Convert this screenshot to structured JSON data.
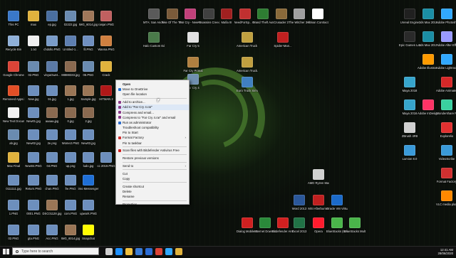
{
  "desktop_icons": [
    {
      "id": "this-pc",
      "label": "This PC",
      "color": "#3a78c9"
    },
    {
      "id": "max",
      "label": "max",
      "color": "#e0b23d"
    },
    {
      "id": "ep",
      "label": "ep.jpg",
      "color": "#4a6fa0"
    },
    {
      "id": "f0222",
      "label": "02222.jpg",
      "color": "#6a8bb0"
    },
    {
      "id": "img6014",
      "label": "IMG_6014.jpg",
      "color": "#a0785a"
    },
    {
      "id": "ranjan",
      "label": "ranjan.PNG",
      "color": "#c06060"
    },
    {
      "id": "recycle",
      "label": "Recycle Bin",
      "color": "#8fb0d8"
    },
    {
      "id": "one-txt",
      "label": "1.txt",
      "color": "#f0f0f0"
    },
    {
      "id": "chdollo",
      "label": "chdollo.PNG",
      "color": "#7a9cc8"
    },
    {
      "id": "untitled1",
      "label": "Untitled-1...",
      "color": "#5e7fb0"
    },
    {
      "id": "fil",
      "label": "fil.PNG",
      "color": "#7090c0"
    },
    {
      "id": "wanna",
      "label": "Wanna.PNG",
      "color": "#d08040"
    },
    {
      "id": "chrome",
      "label": "Google Chrome",
      "color": "#db4437"
    },
    {
      "id": "f02",
      "label": "02.PNG",
      "color": "#6a8bb0"
    },
    {
      "id": "vinyaw",
      "label": "vinyaGwet...",
      "color": "#5b7aa6"
    },
    {
      "id": "ss88",
      "label": "88888333.jpg",
      "color": "#8a6a50"
    },
    {
      "id": "f06",
      "label": "06.PNG",
      "color": "#6a8bb0"
    },
    {
      "id": "crack",
      "label": "Crack",
      "color": "#e0b23d"
    },
    {
      "id": "removed",
      "label": "Removed Apps.html",
      "color": "#e34f26"
    },
    {
      "id": "new",
      "label": "New.jpg",
      "color": "#6d8fbd"
    },
    {
      "id": "f91",
      "label": "91.jpg",
      "color": "#6d8fbd"
    },
    {
      "id": "jpg1",
      "label": "1.jpg",
      "color": "#9a7656"
    },
    {
      "id": "sample",
      "label": "Sample.jpg",
      "color": "#9a7656"
    },
    {
      "id": "hitman",
      "label": "HITMAN 2",
      "color": "#b01818"
    },
    {
      "id": "newtext",
      "label": "New Text Document...",
      "color": "#f0f0f0"
    },
    {
      "id": "new01",
      "label": "New01.jpg",
      "color": "#6d8fbd"
    },
    {
      "id": "aaaaa",
      "label": "aaaaa.jpg",
      "color": "#8a6a50"
    },
    {
      "id": "f0jpg",
      "label": "0.jpg",
      "color": "#8a6a50"
    },
    {
      "id": "f2jpg",
      "label": "2.jpg",
      "color": "#8a6a50"
    },
    {
      "id": "ab",
      "label": "ab.jpg",
      "color": "#6a8bb0"
    },
    {
      "id": "new02",
      "label": "New02.jpg",
      "color": "#6d8fbd"
    },
    {
      "id": "f2e",
      "label": "2e.png",
      "color": "#6d8fbd"
    },
    {
      "id": "wome2",
      "label": "Wome2.PNG",
      "color": "#6d8fbd"
    },
    {
      "id": "new03",
      "label": "New03.jpg",
      "color": "#6d8fbd"
    },
    {
      "id": "maxfinal",
      "label": "Max Final",
      "color": "#e0b23d"
    },
    {
      "id": "new04",
      "label": "New04.PNG",
      "color": "#6d8fbd"
    },
    {
      "id": "f04",
      "label": "04.PNG",
      "color": "#6d8fbd"
    },
    {
      "id": "up",
      "label": "up.png",
      "color": "#6d8fbd"
    },
    {
      "id": "ludo",
      "label": "ludo.jpg",
      "color": "#6d8fbd"
    },
    {
      "id": "cc2019",
      "label": "cc 2019.PNG",
      "color": "#6d8fbd"
    },
    {
      "id": "s0111",
      "label": "0111111.jpg",
      "color": "#6d8fbd"
    },
    {
      "id": "return",
      "label": "Return.PNG",
      "color": "#6d8fbd"
    },
    {
      "id": "chan",
      "label": "chan.PNG",
      "color": "#6d8fbd"
    },
    {
      "id": "fre",
      "label": "fre.PNG",
      "color": "#6d8fbd"
    },
    {
      "id": "imo",
      "label": "imo Messenger",
      "color": "#1f6fd6"
    },
    {
      "id": "f1png",
      "label": "1.PNG",
      "color": "#6d8fbd"
    },
    {
      "id": "f0001",
      "label": "0001.PNG",
      "color": "#6d8fbd"
    },
    {
      "id": "dsc",
      "label": "DSC01128.jpg",
      "color": "#9a7656"
    },
    {
      "id": "com",
      "label": "com.PNG",
      "color": "#6d8fbd"
    },
    {
      "id": "upwork",
      "label": "upwork.PNG",
      "color": "#6d8fbd"
    },
    {
      "id": "f02b",
      "label": "02.PNG",
      "color": "#6d8fbd"
    },
    {
      "id": "gta",
      "label": "gta.PNG",
      "color": "#6d8fbd"
    },
    {
      "id": "acc",
      "label": "Acc.PNG",
      "color": "#6d8fbd"
    },
    {
      "id": "img6014b",
      "label": "IMG_6014.jpg",
      "color": "#9a7656"
    },
    {
      "id": "snapchat",
      "label": "Snapchat",
      "color": "#fffc00"
    },
    {
      "id": "gtasa",
      "label": "MTA: San Andreas 1.5",
      "color": "#5a5a5a"
    },
    {
      "id": "rottr",
      "label": "Rise Of The Tomb Raider",
      "color": "#7a5b3a"
    },
    {
      "id": "fc-new-dawn",
      "label": "Far Cry - New Dawn",
      "color": "#c0407a"
    },
    {
      "id": "ac-od",
      "label": "Assassins Creed O...",
      "color": "#404040"
    },
    {
      "id": "mafia",
      "label": "Mafia III",
      "color": "#a02020"
    },
    {
      "id": "nfs",
      "label": "NeedForSp... Payback",
      "color": "#c03030"
    },
    {
      "id": "gtav",
      "label": "Grand Theft Auto V",
      "color": "#2e7d32"
    },
    {
      "id": "crusader",
      "label": "Crusader 3",
      "color": "#8a6a3a"
    },
    {
      "id": "witcher",
      "label": "The Witcher 3 Enhanced...",
      "color": "#a0a0a0"
    },
    {
      "id": "hitman-abs",
      "label": "Hitman Contracts...",
      "color": "#ffffff"
    },
    {
      "id": "halo",
      "label": "Halo Custom Edition",
      "color": "#4a7a4a"
    },
    {
      "id": "fc5",
      "label": "Far Cry 5",
      "color": "#e0e0e0"
    },
    {
      "id": "ats",
      "label": "American Truck Si...",
      "color": "#c0a040"
    },
    {
      "id": "spider",
      "label": "Spider-Man...",
      "color": "#c02020"
    },
    {
      "id": "fc-primal",
      "label": "Far Cry Primal",
      "color": "#b08040"
    },
    {
      "id": "american2",
      "label": "American Truck...",
      "color": "#c0a040"
    },
    {
      "id": "fc4",
      "label": "Far Cry 4",
      "color": "#7090b0"
    },
    {
      "id": "ets2",
      "label": "Euro Truck Simulator 2",
      "color": "#4080c0"
    },
    {
      "id": "amd",
      "label": "AMD Ryzen Master",
      "color": "#d0d0d0"
    },
    {
      "id": "word",
      "label": "Word 2013",
      "color": "#2b579a"
    },
    {
      "id": "msi",
      "label": "MSI Afterburner",
      "color": "#c02020"
    },
    {
      "id": "vbox",
      "label": "Oracle VM VirtualBox",
      "color": "#1b6ac9"
    },
    {
      "id": "dialog",
      "label": "Dialog Mobile B...",
      "color": "#d02020"
    },
    {
      "id": "idm",
      "label": "Internet Downlo...",
      "color": "#2a8a3a"
    },
    {
      "id": "bitdef",
      "label": "Bitdefender Antivirus Free",
      "color": "#d02020"
    },
    {
      "id": "excel",
      "label": "Excel 2013",
      "color": "#217346"
    },
    {
      "id": "opera",
      "label": "Opera",
      "color": "#ff1b2d"
    },
    {
      "id": "bluestacks",
      "label": "BlueStacks (64-bit)",
      "color": "#4ab54a"
    },
    {
      "id": "bluestacks-multi",
      "label": "BlueStacks Multi-Insta...",
      "color": "#4ab54a"
    },
    {
      "id": "unreal",
      "label": "Unreal Engine",
      "color": "#202020"
    },
    {
      "id": "3dsmax2019",
      "label": "3ds Max 2019",
      "color": "#1b8ea5"
    },
    {
      "id": "photoshop",
      "label": "Adobe Photosh...",
      "color": "#31a8ff"
    },
    {
      "id": "aftereffects",
      "label": "Adobe After Effects 2019",
      "color": "#9999ff"
    },
    {
      "id": "epic",
      "label": "Epic Games Launcher",
      "color": "#2a2a2a"
    },
    {
      "id": "3dsmax2017",
      "label": "3ds Max 2017",
      "color": "#1b8ea5"
    },
    {
      "id": "illustrator",
      "label": "Adobe Illustrat...",
      "color": "#ff9a00"
    },
    {
      "id": "lightroom",
      "label": "Adobe Lightroom...",
      "color": "#31a8ff"
    },
    {
      "id": "maya2018",
      "label": "Maya 2018",
      "color": "#37a5cc"
    },
    {
      "id": "animate",
      "label": "Adobe Animate...",
      "color": "#d62828"
    },
    {
      "id": "maya2016",
      "label": "Maya 2016",
      "color": "#37a5cc"
    },
    {
      "id": "indesign",
      "label": "Adobe InDesign...",
      "color": "#ff3366"
    },
    {
      "id": "wondershare",
      "label": "Wondershare Filmora",
      "color": "#3ad0a0"
    },
    {
      "id": "zbrush",
      "label": "ZBrush 4R8",
      "color": "#d0d0d0"
    },
    {
      "id": "explorelio",
      "label": "Explorelio",
      "color": "#e03030"
    },
    {
      "id": "lumion",
      "label": "Lumion 8.0",
      "color": "#3a9ad9"
    },
    {
      "id": "videoscribe",
      "label": "VideoScribe",
      "color": "#3a9ad9"
    },
    {
      "id": "format-factory",
      "label": "Format Factory",
      "color": "#d03030"
    },
    {
      "id": "vlc",
      "label": "VLC media player",
      "color": "#ff8800"
    }
  ],
  "context_menu": {
    "items": [
      {
        "label": "Open",
        "bold": true,
        "icon": "",
        "submenu": false
      },
      {
        "label": "Move to OneDrive",
        "icon": "onedrive-icon",
        "icon_color": "#1d6fd6",
        "submenu": false
      },
      {
        "label": "Open file location",
        "icon": "",
        "submenu": false
      },
      {
        "sep": true
      },
      {
        "label": "Add to archive...",
        "icon": "winrar-icon",
        "icon_color": "#8a3a8a",
        "submenu": false
      },
      {
        "label": "Add to \"Far Cry 4.rar\"",
        "icon": "winrar-icon",
        "icon_color": "#8a3a8a",
        "submenu": false
      },
      {
        "label": "Compress and email...",
        "icon": "winrar-icon",
        "icon_color": "#8a3a8a",
        "submenu": false
      },
      {
        "label": "Compress to \"Far Cry 4.rar\" and email",
        "icon": "winrar-icon",
        "icon_color": "#8a3a8a",
        "submenu": false
      },
      {
        "label": "Run as administrator",
        "icon": "shield-icon",
        "icon_color": "#2b6ccc",
        "submenu": false
      },
      {
        "label": "Troubleshoot compatibility",
        "icon": "",
        "submenu": false
      },
      {
        "label": "Pin to Start",
        "icon": "",
        "submenu": false
      },
      {
        "label": "Format Factory",
        "icon": "format-factory-icon",
        "icon_color": "#d03030",
        "submenu": true
      },
      {
        "label": "Pin to taskbar",
        "icon": "",
        "submenu": false
      },
      {
        "sep": true
      },
      {
        "label": "Scan files with Bitdefender Antivirus Free",
        "icon": "bitdefender-icon",
        "icon_color": "#d02020",
        "submenu": false
      },
      {
        "sep": true
      },
      {
        "label": "Restore previous versions",
        "icon": "",
        "submenu": false
      },
      {
        "sep": true
      },
      {
        "label": "Send to",
        "icon": "",
        "submenu": true
      },
      {
        "sep": true
      },
      {
        "label": "Cut",
        "icon": "",
        "submenu": false
      },
      {
        "label": "Copy",
        "icon": "",
        "submenu": false
      },
      {
        "sep": true
      },
      {
        "label": "Create shortcut",
        "icon": "",
        "submenu": false
      },
      {
        "label": "Delete",
        "icon": "",
        "submenu": false
      },
      {
        "label": "Rename",
        "icon": "",
        "submenu": false
      },
      {
        "sep": true
      },
      {
        "label": "Properties",
        "icon": "",
        "submenu": false
      }
    ]
  },
  "taskbar": {
    "search_placeholder": "Type here to search",
    "apps": [
      {
        "id": "task-view",
        "color": "#cfcfcf"
      },
      {
        "id": "edge",
        "color": "#1e90ff"
      },
      {
        "id": "file-explorer",
        "color": "#f0c040"
      },
      {
        "id": "store",
        "color": "#3a7bd5"
      },
      {
        "id": "mail",
        "color": "#2b6cd4"
      },
      {
        "id": "chrome",
        "color": "#db4437"
      },
      {
        "id": "photoshop",
        "color": "#31a8ff"
      },
      {
        "id": "explorer2",
        "color": "#e0b23d"
      }
    ],
    "time": "12:41 AM",
    "date": "28/06/2020"
  }
}
